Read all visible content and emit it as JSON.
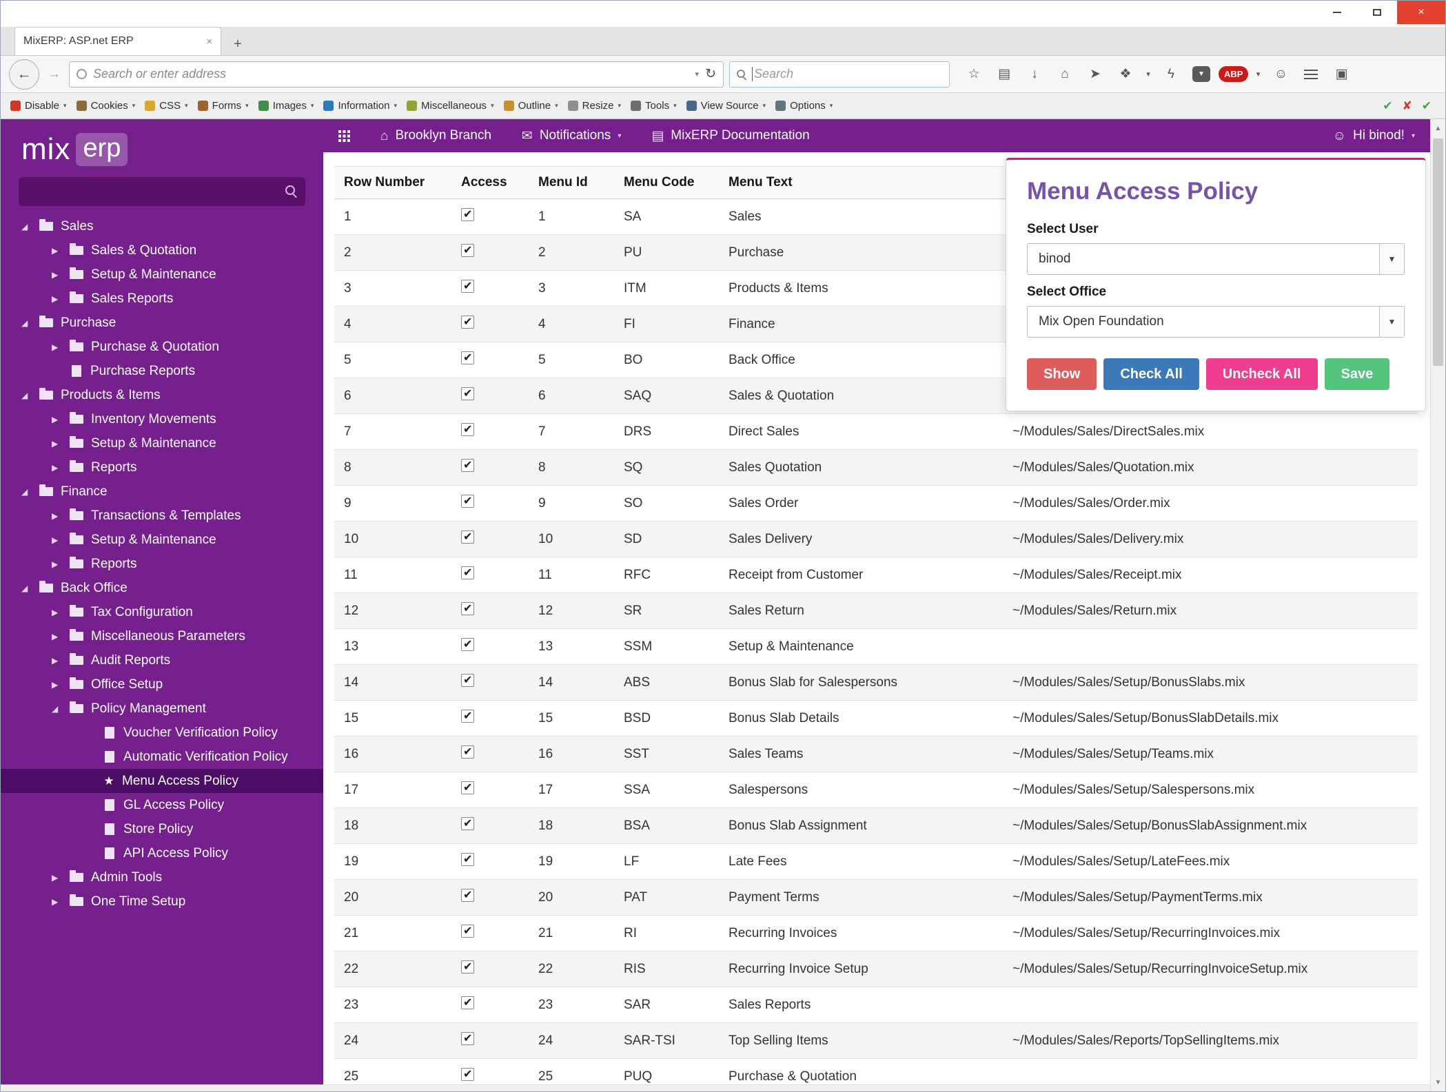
{
  "window": {
    "tab_title": "MixERP: ASP.net ERP"
  },
  "browser": {
    "url_placeholder": "Search or enter address",
    "search_placeholder": "Search",
    "webdev_items": [
      {
        "label": "Disable",
        "color": "#cf3a28"
      },
      {
        "label": "Cookies",
        "color": "#8a6d3b"
      },
      {
        "label": "CSS",
        "color": "#d9a62e"
      },
      {
        "label": "Forms",
        "color": "#a0622d"
      },
      {
        "label": "Images",
        "color": "#3f8f4a"
      },
      {
        "label": "Information",
        "color": "#2e79b8"
      },
      {
        "label": "Miscellaneous",
        "color": "#93a13a"
      },
      {
        "label": "Outline",
        "color": "#c78f2e"
      },
      {
        "label": "Resize",
        "color": "#8f8f8f"
      },
      {
        "label": "Tools",
        "color": "#6e6e6e"
      },
      {
        "label": "View Source",
        "color": "#4a6785"
      },
      {
        "label": "Options",
        "color": "#5f7585"
      }
    ],
    "status_icons": [
      {
        "glyph": "✔",
        "color": "#3fa142"
      },
      {
        "glyph": "✘",
        "color": "#d23b2f"
      },
      {
        "glyph": "✔",
        "color": "#3fa142"
      }
    ]
  },
  "appbar": {
    "branch": "Brooklyn Branch",
    "notifications": "Notifications",
    "documentation": "MixERP Documentation",
    "greeting": "Hi binod!"
  },
  "sidebar": {
    "logo_mix": "mix",
    "logo_erp": "erp",
    "tree": [
      {
        "label": "Sales",
        "level": 0,
        "icon": "folder",
        "state": "expanded"
      },
      {
        "label": "Sales & Quotation",
        "level": 1,
        "icon": "folder",
        "state": "collapsed"
      },
      {
        "label": "Setup & Maintenance",
        "level": 1,
        "icon": "folder",
        "state": "collapsed"
      },
      {
        "label": "Sales Reports",
        "level": 1,
        "icon": "folder",
        "state": "collapsed"
      },
      {
        "label": "Purchase",
        "level": 0,
        "icon": "folder",
        "state": "expanded"
      },
      {
        "label": "Purchase & Quotation",
        "level": 1,
        "icon": "folder",
        "state": "collapsed"
      },
      {
        "label": "Purchase Reports",
        "level": 1,
        "icon": "file",
        "state": "none"
      },
      {
        "label": "Products & Items",
        "level": 0,
        "icon": "folder",
        "state": "expanded"
      },
      {
        "label": "Inventory Movements",
        "level": 1,
        "icon": "folder",
        "state": "collapsed"
      },
      {
        "label": "Setup & Maintenance",
        "level": 1,
        "icon": "folder",
        "state": "collapsed"
      },
      {
        "label": "Reports",
        "level": 1,
        "icon": "folder",
        "state": "collapsed"
      },
      {
        "label": "Finance",
        "level": 0,
        "icon": "folder",
        "state": "expanded"
      },
      {
        "label": "Transactions & Templates",
        "level": 1,
        "icon": "folder",
        "state": "collapsed"
      },
      {
        "label": "Setup & Maintenance",
        "level": 1,
        "icon": "folder",
        "state": "collapsed"
      },
      {
        "label": "Reports",
        "level": 1,
        "icon": "folder",
        "state": "collapsed"
      },
      {
        "label": "Back Office",
        "level": 0,
        "icon": "folder",
        "state": "expanded"
      },
      {
        "label": "Tax Configuration",
        "level": 1,
        "icon": "folder",
        "state": "collapsed"
      },
      {
        "label": "Miscellaneous Parameters",
        "level": 1,
        "icon": "folder",
        "state": "collapsed"
      },
      {
        "label": "Audit Reports",
        "level": 1,
        "icon": "folder",
        "state": "collapsed"
      },
      {
        "label": "Office Setup",
        "level": 1,
        "icon": "folder",
        "state": "collapsed"
      },
      {
        "label": "Policy Management",
        "level": 1,
        "icon": "folder",
        "state": "expanded"
      },
      {
        "label": "Voucher Verification Policy",
        "level": 2,
        "icon": "file",
        "state": "none"
      },
      {
        "label": "Automatic Verification Policy",
        "level": 2,
        "icon": "file",
        "state": "none"
      },
      {
        "label": "Menu Access Policy",
        "level": 2,
        "icon": "star",
        "state": "none",
        "selected": true
      },
      {
        "label": "GL Access Policy",
        "level": 2,
        "icon": "file",
        "state": "none"
      },
      {
        "label": "Store Policy",
        "level": 2,
        "icon": "file",
        "state": "none"
      },
      {
        "label": "API Access Policy",
        "level": 2,
        "icon": "file",
        "state": "none"
      },
      {
        "label": "Admin Tools",
        "level": 1,
        "icon": "folder",
        "state": "collapsed"
      },
      {
        "label": "One Time Setup",
        "level": 1,
        "icon": "folder",
        "state": "collapsed"
      }
    ]
  },
  "panel": {
    "title": "Menu Access Policy",
    "user_label": "Select User",
    "user_value": "binod",
    "office_label": "Select Office",
    "office_value": "Mix Open Foundation",
    "buttons": [
      {
        "label": "Show",
        "color": "#df5c5c",
        "name": "show-button"
      },
      {
        "label": "Check All",
        "color": "#3b79b8",
        "name": "check-all-button"
      },
      {
        "label": "Uncheck All",
        "color": "#ef3e90",
        "name": "uncheck-all-button"
      },
      {
        "label": "Save",
        "color": "#55c57e",
        "name": "save-button"
      }
    ]
  },
  "table": {
    "headers": {
      "row_number": "Row Number",
      "access": "Access",
      "menu_id": "Menu Id",
      "menu_code": "Menu Code",
      "menu_text": "Menu Text",
      "path": ""
    },
    "rows": [
      {
        "row": 1,
        "access": true,
        "id": 1,
        "code": "SA",
        "text": "Sales",
        "path": ""
      },
      {
        "row": 2,
        "access": true,
        "id": 2,
        "code": "PU",
        "text": "Purchase",
        "path": ""
      },
      {
        "row": 3,
        "access": true,
        "id": 3,
        "code": "ITM",
        "text": "Products & Items",
        "path": ""
      },
      {
        "row": 4,
        "access": true,
        "id": 4,
        "code": "FI",
        "text": "Finance",
        "path": ""
      },
      {
        "row": 5,
        "access": true,
        "id": 5,
        "code": "BO",
        "text": "Back Office",
        "path": ""
      },
      {
        "row": 6,
        "access": true,
        "id": 6,
        "code": "SAQ",
        "text": "Sales & Quotation",
        "path": ""
      },
      {
        "row": 7,
        "access": true,
        "id": 7,
        "code": "DRS",
        "text": "Direct Sales",
        "path": "~/Modules/Sales/DirectSales.mix"
      },
      {
        "row": 8,
        "access": true,
        "id": 8,
        "code": "SQ",
        "text": "Sales Quotation",
        "path": "~/Modules/Sales/Quotation.mix"
      },
      {
        "row": 9,
        "access": true,
        "id": 9,
        "code": "SO",
        "text": "Sales Order",
        "path": "~/Modules/Sales/Order.mix"
      },
      {
        "row": 10,
        "access": true,
        "id": 10,
        "code": "SD",
        "text": "Sales Delivery",
        "path": "~/Modules/Sales/Delivery.mix"
      },
      {
        "row": 11,
        "access": true,
        "id": 11,
        "code": "RFC",
        "text": "Receipt from Customer",
        "path": "~/Modules/Sales/Receipt.mix"
      },
      {
        "row": 12,
        "access": true,
        "id": 12,
        "code": "SR",
        "text": "Sales Return",
        "path": "~/Modules/Sales/Return.mix"
      },
      {
        "row": 13,
        "access": true,
        "id": 13,
        "code": "SSM",
        "text": "Setup & Maintenance",
        "path": ""
      },
      {
        "row": 14,
        "access": true,
        "id": 14,
        "code": "ABS",
        "text": "Bonus Slab for Salespersons",
        "path": "~/Modules/Sales/Setup/BonusSlabs.mix"
      },
      {
        "row": 15,
        "access": true,
        "id": 15,
        "code": "BSD",
        "text": "Bonus Slab Details",
        "path": "~/Modules/Sales/Setup/BonusSlabDetails.mix"
      },
      {
        "row": 16,
        "access": true,
        "id": 16,
        "code": "SST",
        "text": "Sales Teams",
        "path": "~/Modules/Sales/Setup/Teams.mix"
      },
      {
        "row": 17,
        "access": true,
        "id": 17,
        "code": "SSA",
        "text": "Salespersons",
        "path": "~/Modules/Sales/Setup/Salespersons.mix"
      },
      {
        "row": 18,
        "access": true,
        "id": 18,
        "code": "BSA",
        "text": "Bonus Slab Assignment",
        "path": "~/Modules/Sales/Setup/BonusSlabAssignment.mix"
      },
      {
        "row": 19,
        "access": true,
        "id": 19,
        "code": "LF",
        "text": "Late Fees",
        "path": "~/Modules/Sales/Setup/LateFees.mix"
      },
      {
        "row": 20,
        "access": true,
        "id": 20,
        "code": "PAT",
        "text": "Payment Terms",
        "path": "~/Modules/Sales/Setup/PaymentTerms.mix"
      },
      {
        "row": 21,
        "access": true,
        "id": 21,
        "code": "RI",
        "text": "Recurring Invoices",
        "path": "~/Modules/Sales/Setup/RecurringInvoices.mix"
      },
      {
        "row": 22,
        "access": true,
        "id": 22,
        "code": "RIS",
        "text": "Recurring Invoice Setup",
        "path": "~/Modules/Sales/Setup/RecurringInvoiceSetup.mix"
      },
      {
        "row": 23,
        "access": true,
        "id": 23,
        "code": "SAR",
        "text": "Sales Reports",
        "path": ""
      },
      {
        "row": 24,
        "access": true,
        "id": 24,
        "code": "SAR-TSI",
        "text": "Top Selling Items",
        "path": "~/Modules/Sales/Reports/TopSellingItems.mix"
      },
      {
        "row": 25,
        "access": true,
        "id": 25,
        "code": "PUQ",
        "text": "Purchase & Quotation",
        "path": ""
      }
    ]
  },
  "icons": {
    "close": "×",
    "tab_close": "×",
    "new_tab": "+",
    "back": "←",
    "forward": "→",
    "reload": "↻",
    "caret": "▾",
    "star": "☆",
    "library": "▤",
    "download": "↓",
    "home": "⌂",
    "send": "➤",
    "theme": "❖",
    "extension": "ϟ",
    "pocket": "▼",
    "abp": "ABP",
    "chat": "☺",
    "panel_view": "▣",
    "branch_home": "⌂",
    "mail": "✉",
    "book": "▤",
    "smiley": "☺",
    "tree_expanded": "◢",
    "tree_collapsed": "▶",
    "star_solid": "★",
    "select_caret": "▼",
    "scroll_up": "▲",
    "scroll_down": "▼"
  },
  "colors": {
    "primary_purple": "#75208c",
    "sidebar_selected": "#4c0d66",
    "panel_accent_pink": "#ed127b"
  }
}
